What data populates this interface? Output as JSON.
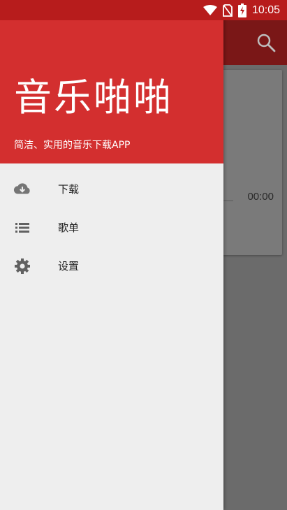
{
  "status_bar": {
    "time": "10:05",
    "icons": [
      "wifi-icon",
      "no-sim-icon",
      "battery-charging-icon"
    ]
  },
  "drawer": {
    "title": "音乐啪啪",
    "subtitle": "简洁、实用的音乐下载APP",
    "items": [
      {
        "label": "下载",
        "icon": "cloud-download-icon"
      },
      {
        "label": "歌单",
        "icon": "list-icon"
      },
      {
        "label": "设置",
        "icon": "gear-icon"
      }
    ]
  },
  "background_app": {
    "card_time": "00:00",
    "toolbar_icon": "search-icon"
  },
  "colors": {
    "status_bar": "#b71c1c",
    "drawer_header": "#d32f2f",
    "drawer_bg": "#eeeeee",
    "scrim": "#6b6b6b"
  }
}
